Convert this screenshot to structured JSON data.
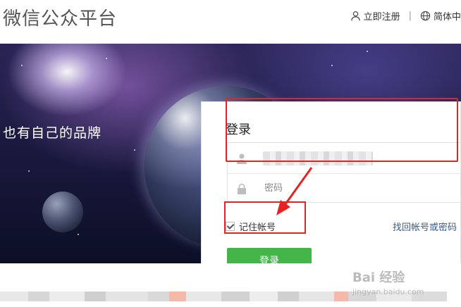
{
  "header": {
    "title": "微信公众平台",
    "register_label": "立即注册",
    "separator": "|",
    "language_label": "简体中"
  },
  "banner": {
    "tagline": "也有自己的品牌"
  },
  "login": {
    "title": "登录",
    "username_value": "",
    "password_placeholder": "密码",
    "remember_label": "记住帐号",
    "remember_checked": true,
    "forgot_label": "找回帐号或密码",
    "submit_label": "登录"
  },
  "colors": {
    "primary_green": "#44b549",
    "highlight_red": "#e62222",
    "link_blue": "#385a8c"
  },
  "watermark": {
    "brand": "Bai 经验",
    "url": "jingyan.baidu.com"
  }
}
